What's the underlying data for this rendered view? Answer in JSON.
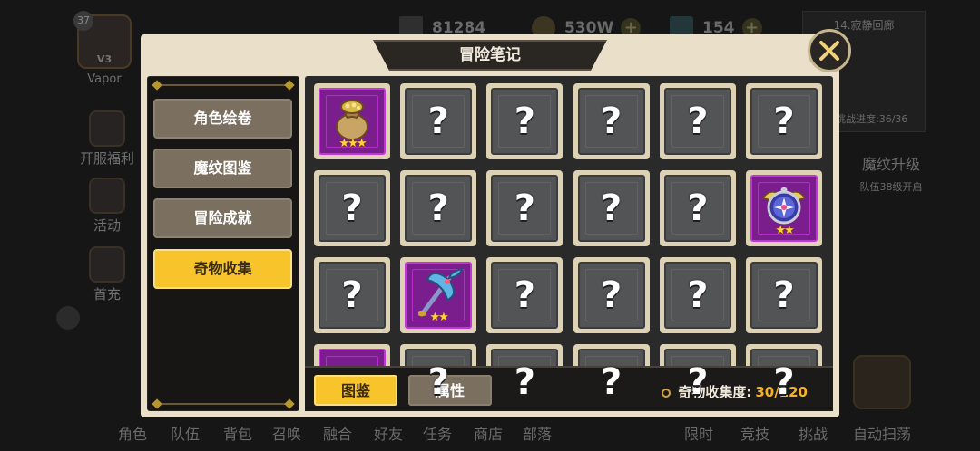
{
  "player": {
    "level": "37",
    "rank": "V3",
    "name": "Vapor"
  },
  "resources": {
    "power": "81284",
    "gold": "530W",
    "gems": "154"
  },
  "minimap": {
    "title": "14.寂静回廊",
    "progress": "挑战进度:36/36"
  },
  "rune_upgrade": {
    "title": "魔纹升级",
    "hint": "队伍38级开启"
  },
  "left_menu": [
    "开服福利",
    "活动",
    "首充"
  ],
  "bottom_nav": [
    "角色",
    "队伍",
    "背包",
    "召唤",
    "融合",
    "好友",
    "任务",
    "商店",
    "部落",
    "限时",
    "竞技",
    "挑战",
    "自动扫荡"
  ],
  "modal": {
    "title": "冒险笔记",
    "sidebar": [
      "角色绘卷",
      "魔纹图鉴",
      "冒险成就",
      "奇物收集"
    ],
    "active_index": 3,
    "tabs": {
      "catalog": "图鉴",
      "attributes": "属性"
    },
    "collection_label": "奇物收集度:",
    "collection_value": "30/120",
    "unknown_mark": "?",
    "grid": [
      {
        "state": "found",
        "icon": "treasure-bag-icon",
        "stars": 3
      },
      {
        "state": "unknown"
      },
      {
        "state": "unknown"
      },
      {
        "state": "unknown"
      },
      {
        "state": "unknown"
      },
      {
        "state": "unknown"
      },
      {
        "state": "unknown"
      },
      {
        "state": "unknown"
      },
      {
        "state": "unknown"
      },
      {
        "state": "unknown"
      },
      {
        "state": "unknown"
      },
      {
        "state": "found",
        "icon": "compass-icon",
        "stars": 2
      },
      {
        "state": "unknown"
      },
      {
        "state": "found",
        "icon": "battle-axe-icon",
        "stars": 2
      },
      {
        "state": "unknown"
      },
      {
        "state": "unknown"
      },
      {
        "state": "unknown"
      },
      {
        "state": "unknown"
      },
      {
        "state": "found",
        "icon": "item-icon"
      },
      {
        "state": "unknown"
      },
      {
        "state": "unknown"
      },
      {
        "state": "unknown"
      },
      {
        "state": "unknown"
      },
      {
        "state": "unknown"
      }
    ]
  },
  "colors": {
    "accent": "#f7c52b",
    "rarity_purple": "#7a1e8e",
    "progress": "#f5b324"
  }
}
